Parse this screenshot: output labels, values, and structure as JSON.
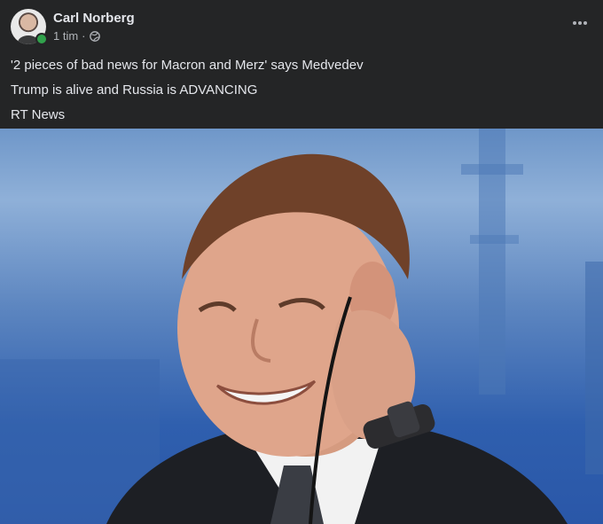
{
  "post": {
    "author": "Carl Norberg",
    "time": "1 tim",
    "separator": "·",
    "privacy_icon": "globe-icon",
    "menu_icon": "more-horizontal-icon",
    "lines": [
      "'2 pieces of bad news for Macron and Merz' says Medvedev",
      "Trump is alive and Russia is ADVANCING",
      "RT News"
    ],
    "image_description_icon": "photo"
  },
  "colors": {
    "background": "#242526",
    "text_primary": "#e4e6eb",
    "text_secondary": "#b0b3b8",
    "online": "#31a24c"
  }
}
